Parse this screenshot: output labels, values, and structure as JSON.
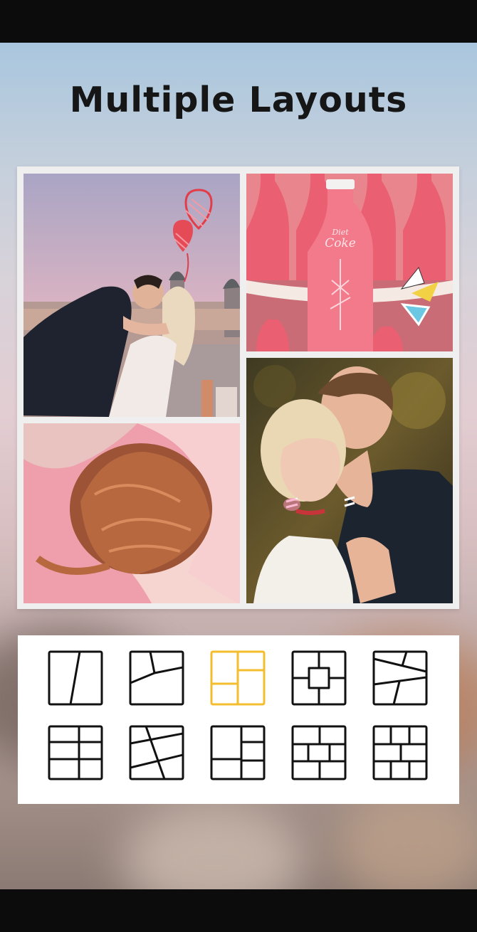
{
  "header": {
    "title": "Multiple Layouts"
  },
  "collage": {
    "photos": [
      {
        "name": "couple-kiss-rooftop",
        "icon": "heart-sticker"
      },
      {
        "name": "pink-coke-bottles",
        "icon": "triangle-sticker"
      },
      {
        "name": "woman-lying-pink-sheets"
      },
      {
        "name": "couple-embrace-forest",
        "icon": "whisker-sticker"
      }
    ]
  },
  "bottle_label": {
    "line1": "Diet",
    "line2": "Coke"
  },
  "layouts": {
    "selected_index": 2,
    "colors": {
      "default": "#111111",
      "selected": "#f3bd2e"
    },
    "items": [
      {
        "id": "diagonal-split"
      },
      {
        "id": "three-angled"
      },
      {
        "id": "grid-2x-split"
      },
      {
        "id": "center-square"
      },
      {
        "id": "angled-stripes"
      },
      {
        "id": "three-row-grid"
      },
      {
        "id": "crossed-angled"
      },
      {
        "id": "four-grid-offset"
      },
      {
        "id": "brick-3x3"
      },
      {
        "id": "brick-4x3"
      }
    ]
  }
}
